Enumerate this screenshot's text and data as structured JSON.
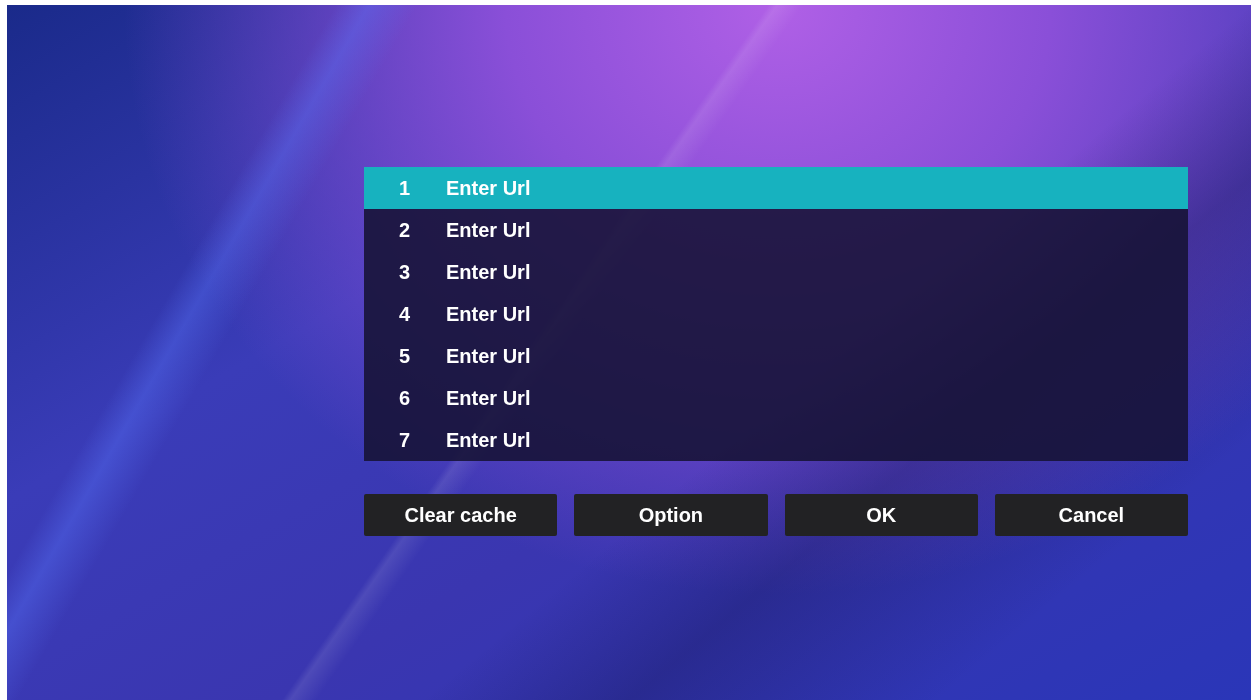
{
  "url_list": [
    {
      "number": "1",
      "label": "Enter Url",
      "selected": true
    },
    {
      "number": "2",
      "label": "Enter Url",
      "selected": false
    },
    {
      "number": "3",
      "label": "Enter Url",
      "selected": false
    },
    {
      "number": "4",
      "label": "Enter Url",
      "selected": false
    },
    {
      "number": "5",
      "label": "Enter Url",
      "selected": false
    },
    {
      "number": "6",
      "label": "Enter Url",
      "selected": false
    },
    {
      "number": "7",
      "label": "Enter Url",
      "selected": false
    }
  ],
  "buttons": [
    "Clear cache",
    "Option",
    "OK",
    "Cancel"
  ]
}
